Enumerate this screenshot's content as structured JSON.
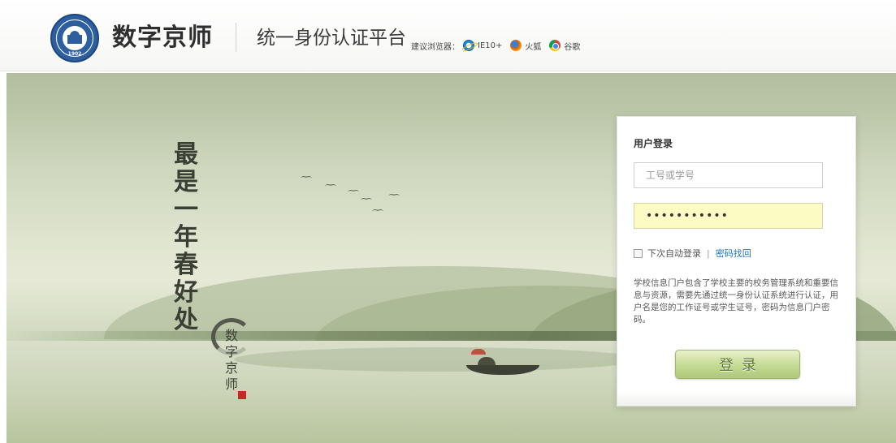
{
  "header": {
    "brand": "数字京师",
    "platform": "统一身份认证平台",
    "browser_hint_label": "建议浏览器：",
    "browsers": [
      {
        "name": "IE10+",
        "icon": "ie-icon"
      },
      {
        "name": "火狐",
        "icon": "firefox-icon"
      },
      {
        "name": "谷歌",
        "icon": "chrome-icon"
      }
    ],
    "seal_year": "1902"
  },
  "hero": {
    "poem_chars": [
      "最",
      "是",
      "一",
      "年",
      "春",
      "好",
      "处"
    ],
    "calligraphy_chars": [
      "数",
      "字",
      "京",
      "师"
    ]
  },
  "login": {
    "title": "用户登录",
    "username_placeholder": "工号或学号",
    "password_value": "•••••••••••",
    "remember_label": "下次自动登录",
    "separator": "|",
    "forgot_link": "密码找回",
    "info_text": "学校信息门户包含了学校主要的校务管理系统和重要信息与资源，需要先通过统一身份认证系统进行认证，用户名是您的工作证号或学生证号，密码为信息门户密码。",
    "login_button": "登录"
  },
  "colors": {
    "login_button": "#c4da93",
    "password_bg": "#fbfbc3",
    "link": "#1a73c4"
  }
}
